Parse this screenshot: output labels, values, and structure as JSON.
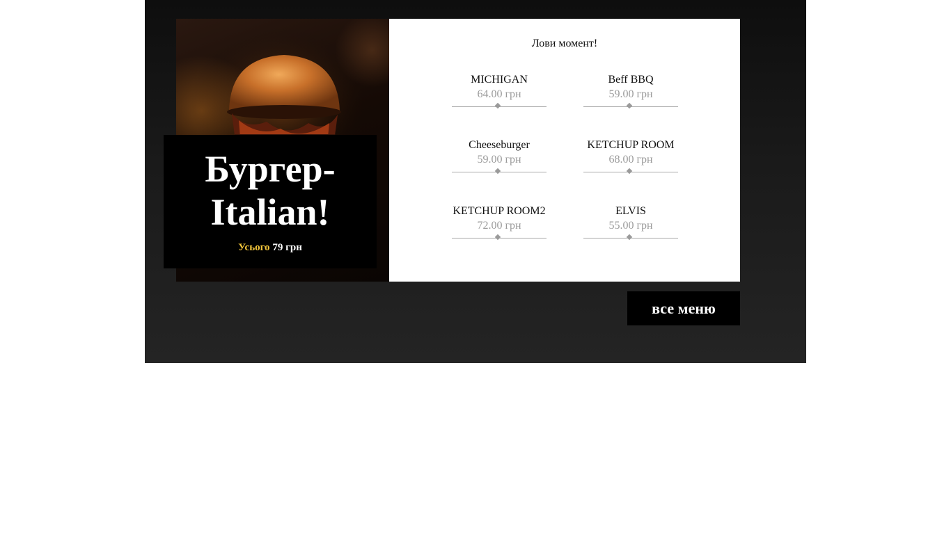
{
  "promo": {
    "title_line1": "Бургер-",
    "title_line2": "Italian!",
    "price_label": "Усього",
    "price_value": "79 грн",
    "accent_color": "#f3c63b"
  },
  "menu": {
    "heading": "Лови момент!",
    "items": [
      {
        "name": "MICHIGAN",
        "price": "64.00 грн"
      },
      {
        "name": "Beff BBQ",
        "price": "59.00 грн"
      },
      {
        "name": "Cheeseburger",
        "price": "59.00 грн"
      },
      {
        "name": "KETCHUP ROOM",
        "price": "68.00 грн"
      },
      {
        "name": "KETCHUP ROOM2",
        "price": "72.00 грн"
      },
      {
        "name": "ELVIS",
        "price": "55.00 грн"
      }
    ]
  },
  "buttons": {
    "all_menu": "все меню"
  },
  "icons": {
    "photo": "burger-photo",
    "divider": "diamond-icon"
  }
}
